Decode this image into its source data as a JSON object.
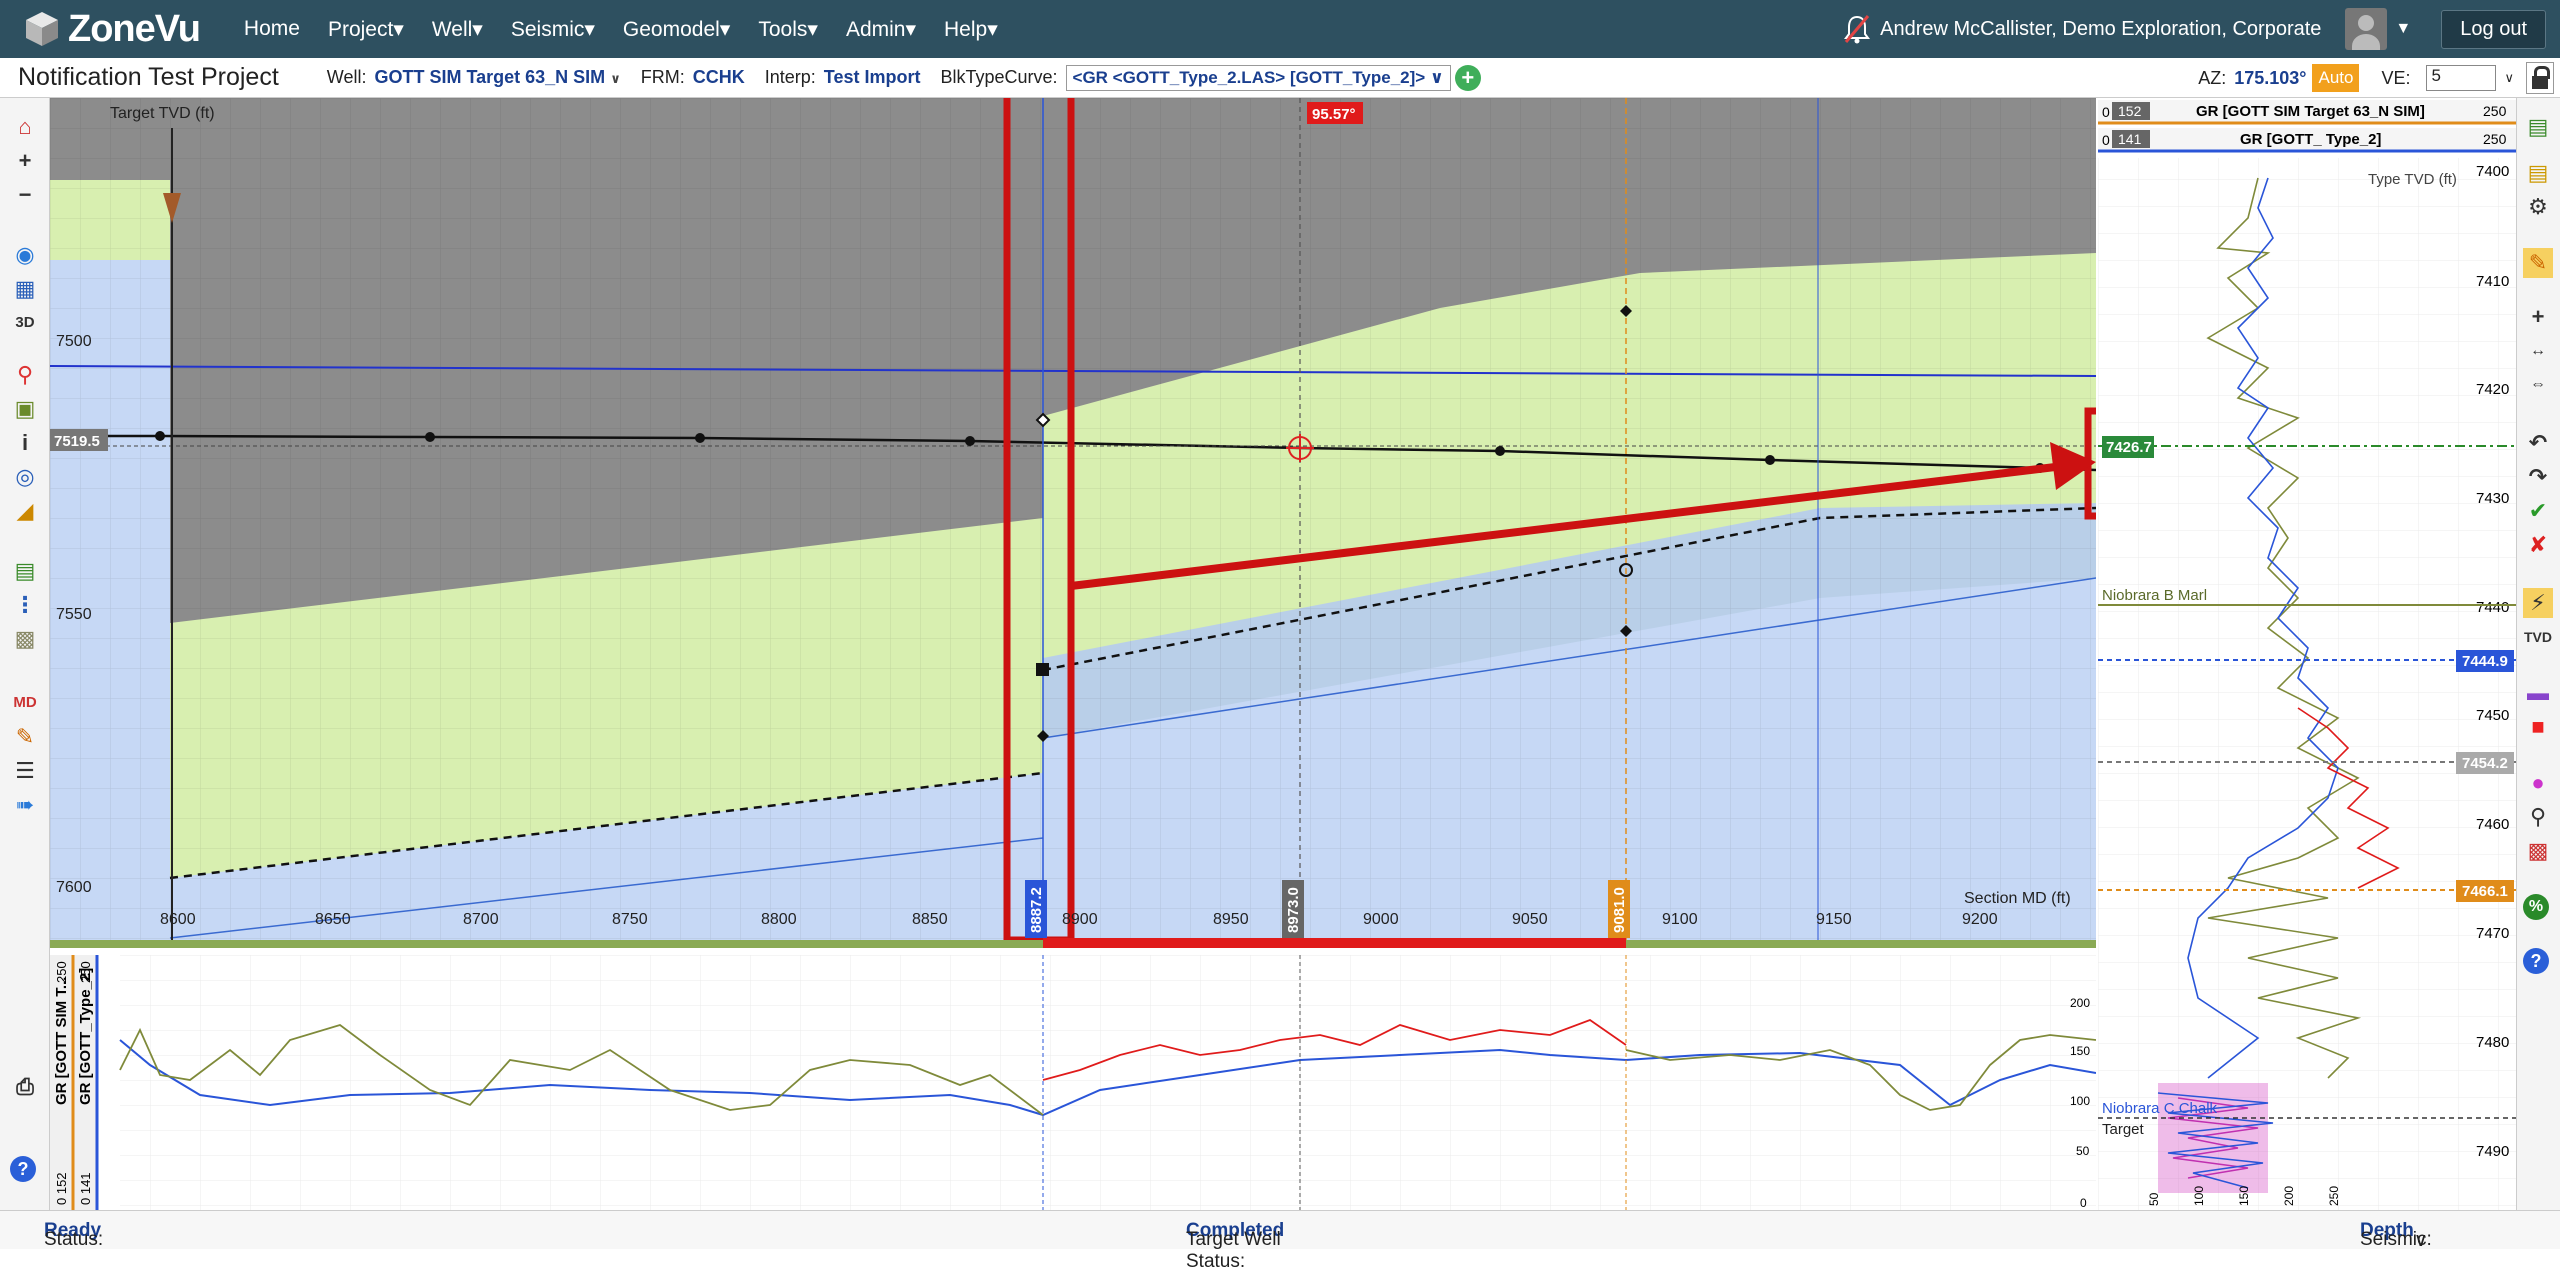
{
  "nav": {
    "brand": "ZoneVu",
    "items": [
      "Home",
      "Project▾",
      "Well▾",
      "Seismic▾",
      "Geomodel▾",
      "Tools▾",
      "Admin▾",
      "Help▾"
    ],
    "user": "Andrew McCallister, Demo Exploration, Corporate",
    "logout": "Log out",
    "icons": [
      "notification-bell-icon",
      "avatar",
      "chevron-down-icon"
    ]
  },
  "subheader": {
    "project_title": "Notification Test Project",
    "well_label": "Well:",
    "well_value": "GOTT SIM Target 63_N SIM",
    "frm_label": "FRM:",
    "frm_value": "CCHK",
    "interp_label": "Interp:",
    "interp_value": "Test Import",
    "blk_label": "BlkTypeCurve:",
    "blk_value": "<GR <GOTT_Type_2.LAS> [GOTT_Type_2]>",
    "az_label": "AZ:",
    "az_value": "175.103°",
    "auto_label": "Auto",
    "ve_label": "VE:",
    "ve_value": "5"
  },
  "section": {
    "target_tvd_label": "Target TVD (ft)",
    "section_md_label": "Section MD (ft)",
    "y_ticks": [
      "7500",
      "7550",
      "7600"
    ],
    "x_ticks": [
      "8600",
      "8650",
      "8700",
      "8750",
      "8800",
      "8850",
      "8900",
      "8950",
      "9000",
      "9050",
      "9100",
      "9150",
      "9200"
    ],
    "tvd_marker": "7519.5",
    "angle_badge": "95.57°",
    "md_markers": [
      "8887.2",
      "8973.0",
      "9081.0"
    ]
  },
  "log_strip": {
    "track_labels": [
      "GR [GOTT SIM T...",
      "GR [GOTT_Type_2]"
    ],
    "track_min": [
      "0 152",
      "0 141"
    ],
    "track_max": [
      "250",
      "250"
    ],
    "y_ticks": [
      "200",
      "150",
      "100",
      "50",
      "0"
    ]
  },
  "type_log": {
    "header1": {
      "min": "0",
      "tag": "152",
      "name": "GR [GOTT SIM Target 63_N SIM]",
      "max": "250"
    },
    "header2": {
      "min": "0",
      "tag": "141",
      "name": "GR [GOTT_ Type_2]",
      "max": "250"
    },
    "tvd_label": "Type TVD (ft)",
    "ticks": [
      "7400",
      "7410",
      "7420",
      "7430",
      "7440",
      "7450",
      "7460",
      "7470",
      "7480",
      "7490"
    ],
    "current_depth": "7426.7",
    "formations": [
      "Niobrara B Marl",
      "Niobrara C Chalk",
      "Target"
    ],
    "depth_badges": [
      "7444.9",
      "7454.2",
      "7466.1"
    ],
    "x_ticks": [
      "50",
      "100",
      "150",
      "200",
      "250"
    ]
  },
  "status": {
    "status_label": "Status:",
    "status_value": "Ready",
    "target_label": "Target Well Status:",
    "target_value": "Completed",
    "seismic_label": "Seismic:",
    "seismic_value": "Depth"
  },
  "colors": {
    "nav": "#2e5060",
    "green_zone": "#d8efb0",
    "blue_zone": "#c6d8f5",
    "gray_zone": "#8c8c8c",
    "annotation": "#cc1111"
  }
}
